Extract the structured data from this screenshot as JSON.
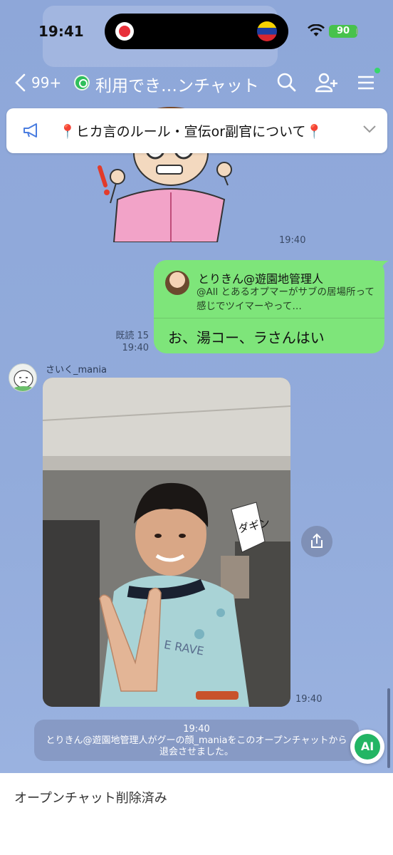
{
  "status_bar": {
    "time": "19:41",
    "battery": "90"
  },
  "nav": {
    "back_count": "99+",
    "title": "利用でき…ンチャット"
  },
  "announcement": {
    "text": "📍ヒカ言のルール・宣伝or副官について📍"
  },
  "messages": {
    "sticker_time": "19:40",
    "reply": {
      "quoted_name": "とりきん@遊園地管理人",
      "quoted_text": "@All とあるオプマーがサブの居場所って感じでツイマーやって…",
      "body": "お、湯コー、ラさんはい",
      "read_label": "既読 15",
      "time": "19:40"
    },
    "incoming": {
      "sender": "さいく_mania",
      "photo_time": "19:40",
      "photo_sign_text": "ダギン",
      "photo_shirt_text": "E RAVE"
    },
    "system": {
      "time": "19:40",
      "text": "とりきん@遊園地管理人がグーの顔_maniaをこのオープンチャットから退会させました。"
    }
  },
  "ai_button": "AI",
  "footer": {
    "text": "オープンチャット削除済み"
  },
  "colors": {
    "chat_bg": "#8fa8d8",
    "bubble_out": "#7ee57a",
    "accent_green": "#22b564"
  }
}
